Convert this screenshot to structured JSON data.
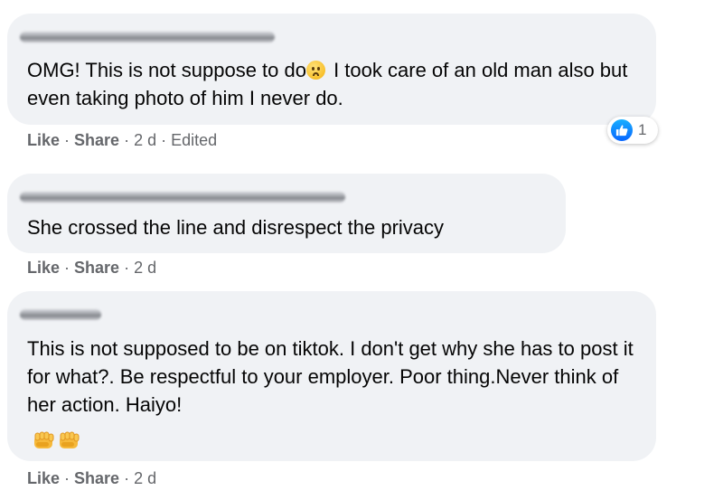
{
  "comments": [
    {
      "text_before_emoji": "OMG! This is not suppose to do",
      "emoji": "worried-face-emoji",
      "text_after_emoji": " I took care of an old man also but even taking photo of him I never do.",
      "actions": {
        "like": "Like",
        "sep1": " · ",
        "share": "Share",
        "sep2": " · ",
        "time": "2 d",
        "sep3": " · ",
        "edited": "Edited"
      },
      "reaction": {
        "icon": "like-icon",
        "count": "1"
      }
    },
    {
      "text": "She crossed the line and disrespect the privacy",
      "actions": {
        "like": "Like",
        "sep1": " · ",
        "share": "Share",
        "sep2": " · ",
        "time": "2 d"
      }
    },
    {
      "text": "This is not supposed to be on tiktok. I don't get why she has to post it for what?. Be respectful to your employer. Poor thing.Never think of her action. Haiyo!",
      "emojis": [
        "oncoming-fist-emoji",
        "oncoming-fist-emoji"
      ],
      "actions": {
        "like": "Like",
        "sep1": " · ",
        "share": "Share",
        "sep2": " · ",
        "time": "2 d"
      }
    }
  ],
  "colors": {
    "bubble": "#f0f2f5",
    "secondary_text": "#65676b",
    "like_blue": "#0866ff"
  }
}
